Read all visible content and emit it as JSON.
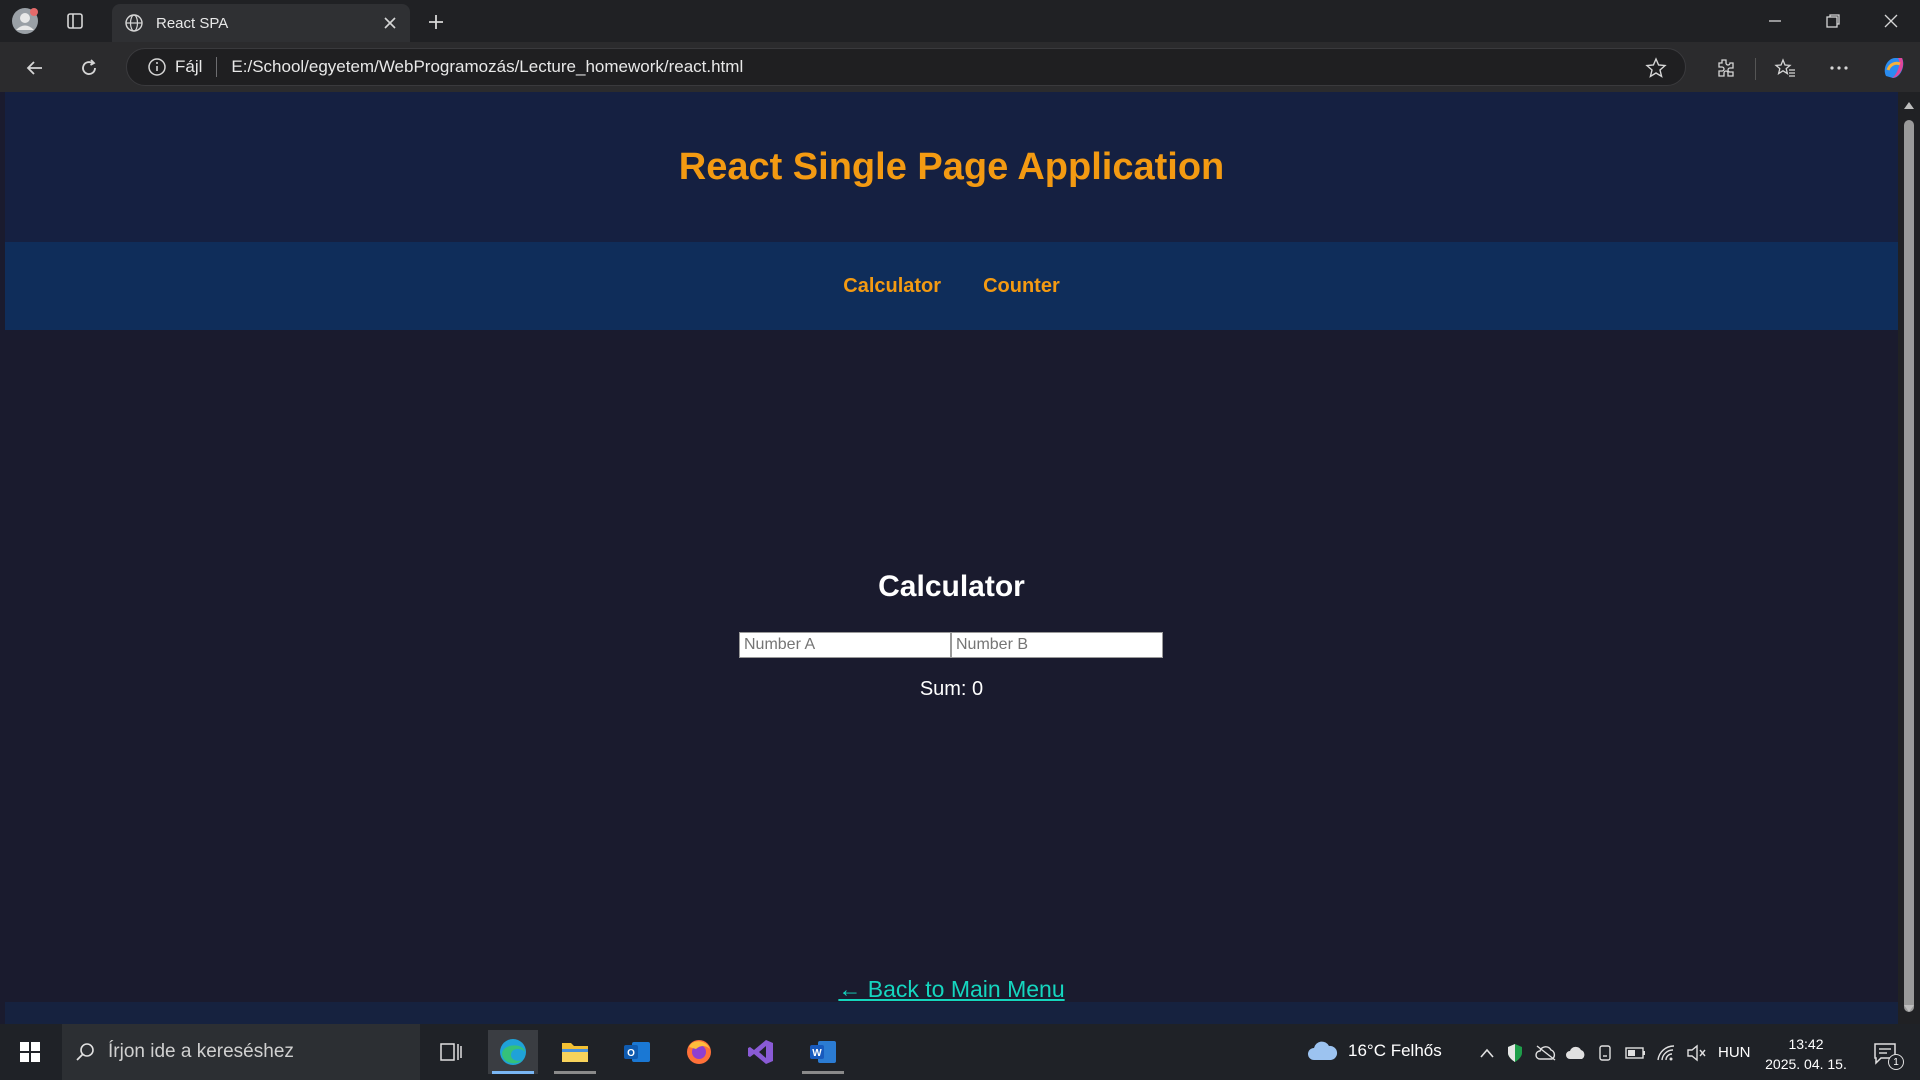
{
  "browser": {
    "tab_title": "React SPA",
    "url_prefix": "Fájl",
    "url": "E:/School/egyetem/WebProgramozás/Lecture_homework/react.html"
  },
  "page": {
    "header_title": "React Single Page Application",
    "nav": [
      "Calculator",
      "Counter"
    ],
    "section_title": "Calculator",
    "input_a_placeholder": "Number A",
    "input_b_placeholder": "Number B",
    "sum_label": "Sum: 0",
    "back_link": "← Back to Main Menu"
  },
  "taskbar": {
    "search_placeholder": "Írjon ide a kereséshez",
    "weather": "16°C  Felhős",
    "language": "HUN",
    "time": "13:42",
    "date": "2025. 04. 15.",
    "notification_count": "1"
  },
  "colors": {
    "accent_orange": "#f39a12",
    "link_teal": "#15d6bf",
    "header_bg": "#152041",
    "nav_bg": "#0f2d5a",
    "page_bg": "#1a1b2e"
  }
}
